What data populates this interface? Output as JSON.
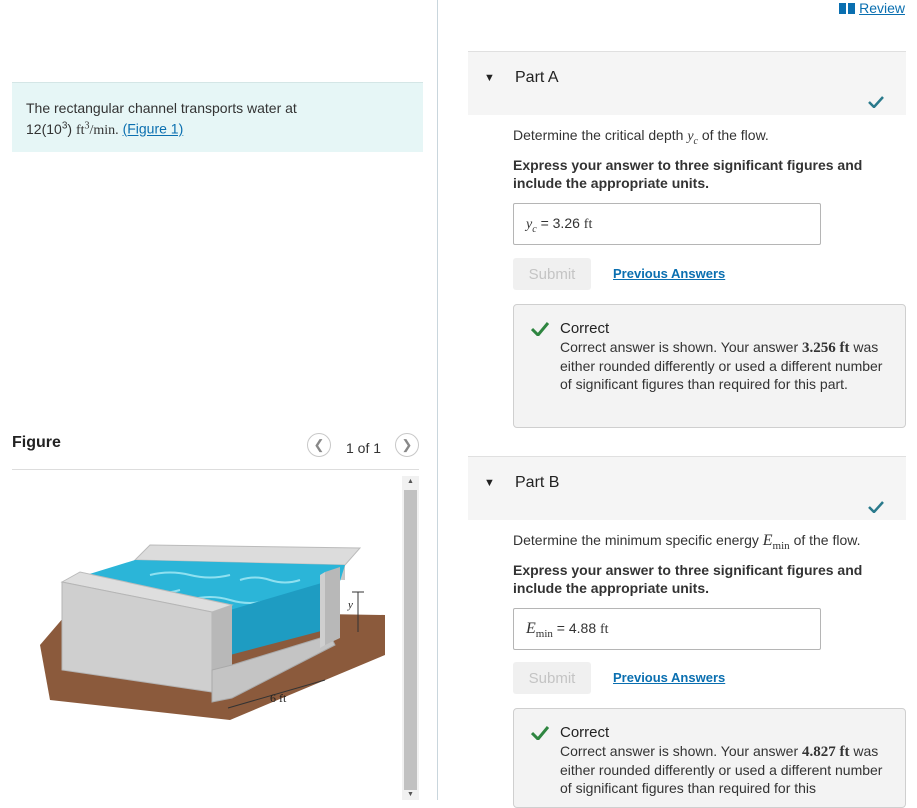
{
  "problem": {
    "text_prefix": "The rectangular channel transports water at",
    "flow_value": "12(10",
    "flow_exp": "3",
    "flow_close": ")",
    "flow_units": "ft",
    "units_exp": "3",
    "units_tail": "/min.",
    "figure_link": "(Figure 1)"
  },
  "figure": {
    "title": "Figure",
    "counter": "1 of 1",
    "dim_width": "6 ft",
    "dim_depth": "y"
  },
  "header": {
    "review_label": "Review"
  },
  "parts": [
    {
      "title": "Part A",
      "question_prefix": "Determine the critical depth",
      "question_var": "y",
      "question_sub": "c",
      "question_suffix": "of the flow.",
      "instruction": "Express your answer to three significant figures and include the appropriate units.",
      "answer_var": "y",
      "answer_sub": "c",
      "answer_eq": "=",
      "answer_value": "3.26",
      "answer_unit": "ft",
      "submit_label": "Submit",
      "prev_label": "Previous Answers",
      "feedback_title": "Correct",
      "feedback_prefix": "Correct answer is shown. Your answer",
      "feedback_value": "3.256 ft",
      "feedback_suffix": "was either rounded differently or used a different number of significant figures than required for this part."
    },
    {
      "title": "Part B",
      "question_prefix": "Determine the minimum specific energy",
      "question_var": "E",
      "question_sub": "min",
      "question_suffix": "of the flow.",
      "instruction": "Express your answer to three significant figures and include the appropriate units.",
      "answer_var": "E",
      "answer_sub": "min",
      "answer_eq": "=",
      "answer_value": "4.88",
      "answer_unit": "ft",
      "submit_label": "Submit",
      "prev_label": "Previous Answers",
      "feedback_title": "Correct",
      "feedback_prefix": "Correct answer is shown. Your answer",
      "feedback_value": "4.827 ft",
      "feedback_suffix": "was either rounded differently or used a different number of significant figures than required for this"
    }
  ],
  "colors": {
    "accent": "#0a6fb0",
    "correct": "#2e8540",
    "problem_bg": "#e6f6f6",
    "water": "#2bb5d8"
  }
}
